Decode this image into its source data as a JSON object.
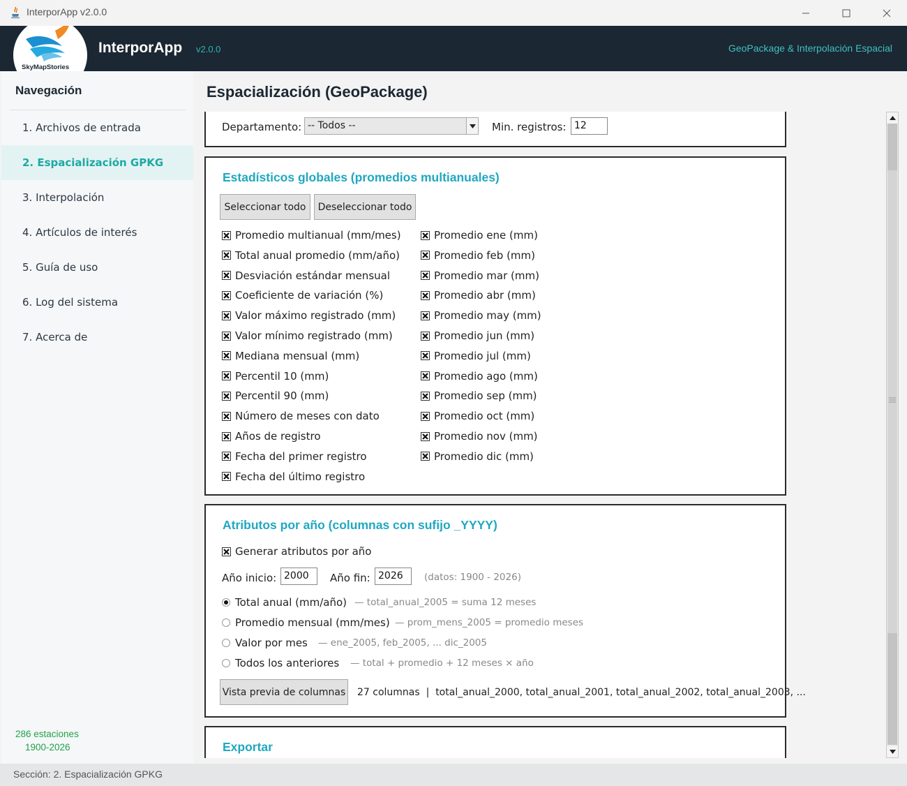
{
  "window": {
    "title": "InterporApp v2.0.0"
  },
  "header": {
    "logo_text": "SkyMapStories",
    "app_name": "InterporApp",
    "version": "v2.0.0",
    "tagline": "GeoPackage & Interpolación Espacial"
  },
  "sidebar": {
    "title": "Navegación",
    "items": [
      {
        "label": "1. Archivos de entrada",
        "active": false
      },
      {
        "label": "2. Espacialización GPKG",
        "active": true
      },
      {
        "label": "3. Interpolación",
        "active": false
      },
      {
        "label": "4. Artículos de interés",
        "active": false
      },
      {
        "label": "5. Guía de uso",
        "active": false
      },
      {
        "label": "6. Log del sistema",
        "active": false
      },
      {
        "label": "7. Acerca de",
        "active": false
      }
    ],
    "stations": "286 estaciones",
    "years": "1900-2026"
  },
  "main": {
    "title": "Espacialización (GeoPackage)",
    "filter": {
      "dept_label": "Departamento:",
      "dept_value": "-- Todos --",
      "min_label": "Min. registros:",
      "min_value": "12"
    },
    "stats": {
      "title": "Estadísticos globales (promedios multianuales)",
      "select_all": "Seleccionar todo",
      "deselect_all": "Deseleccionar todo",
      "left": [
        "Promedio multianual (mm/mes)",
        "Total anual promedio (mm/año)",
        "Desviación estándar mensual",
        "Coeficiente de variación (%)",
        "Valor máximo registrado (mm)",
        "Valor mínimo registrado (mm)",
        "Mediana mensual (mm)",
        "Percentil 10 (mm)",
        "Percentil 90 (mm)",
        "Número de meses con dato",
        "Años de registro",
        "Fecha del primer registro",
        "Fecha del último registro"
      ],
      "right": [
        "Promedio ene (mm)",
        "Promedio feb (mm)",
        "Promedio mar (mm)",
        "Promedio abr (mm)",
        "Promedio may (mm)",
        "Promedio jun (mm)",
        "Promedio jul (mm)",
        "Promedio ago (mm)",
        "Promedio sep (mm)",
        "Promedio oct (mm)",
        "Promedio nov (mm)",
        "Promedio dic (mm)"
      ]
    },
    "yearly": {
      "title": "Atributos por año (columnas con sufijo _YYYY)",
      "generate": "Generar atributos por año",
      "start_label": "Año inicio:",
      "start_value": "2000",
      "end_label": "Año fin:",
      "end_value": "2026",
      "range_note": "(datos: 1900 - 2026)",
      "options": [
        {
          "label": "Total anual (mm/año)",
          "hint": "— total_anual_2005 = suma 12 meses",
          "selected": true
        },
        {
          "label": "Promedio mensual (mm/mes)",
          "hint": "— prom_mens_2005 = promedio meses",
          "selected": false
        },
        {
          "label": "Valor por mes",
          "hint": "— ene_2005, feb_2005, ... dic_2005",
          "selected": false
        },
        {
          "label": "Todos los anteriores",
          "hint": "— total + promedio + 12 meses × año",
          "selected": false
        }
      ],
      "preview_button": "Vista previa de columnas",
      "preview_text": "27 columnas  |  total_anual_2000, total_anual_2001, total_anual_2002, total_anual_2003, ..."
    },
    "export": {
      "title": "Exportar"
    }
  },
  "status": {
    "text": "Sección: 2. Espacialización GPKG"
  },
  "colors": {
    "header_bg": "#1b2733",
    "accent": "#1ea9a4",
    "section_title": "#20a8c0",
    "footer_green": "#21a24a"
  }
}
